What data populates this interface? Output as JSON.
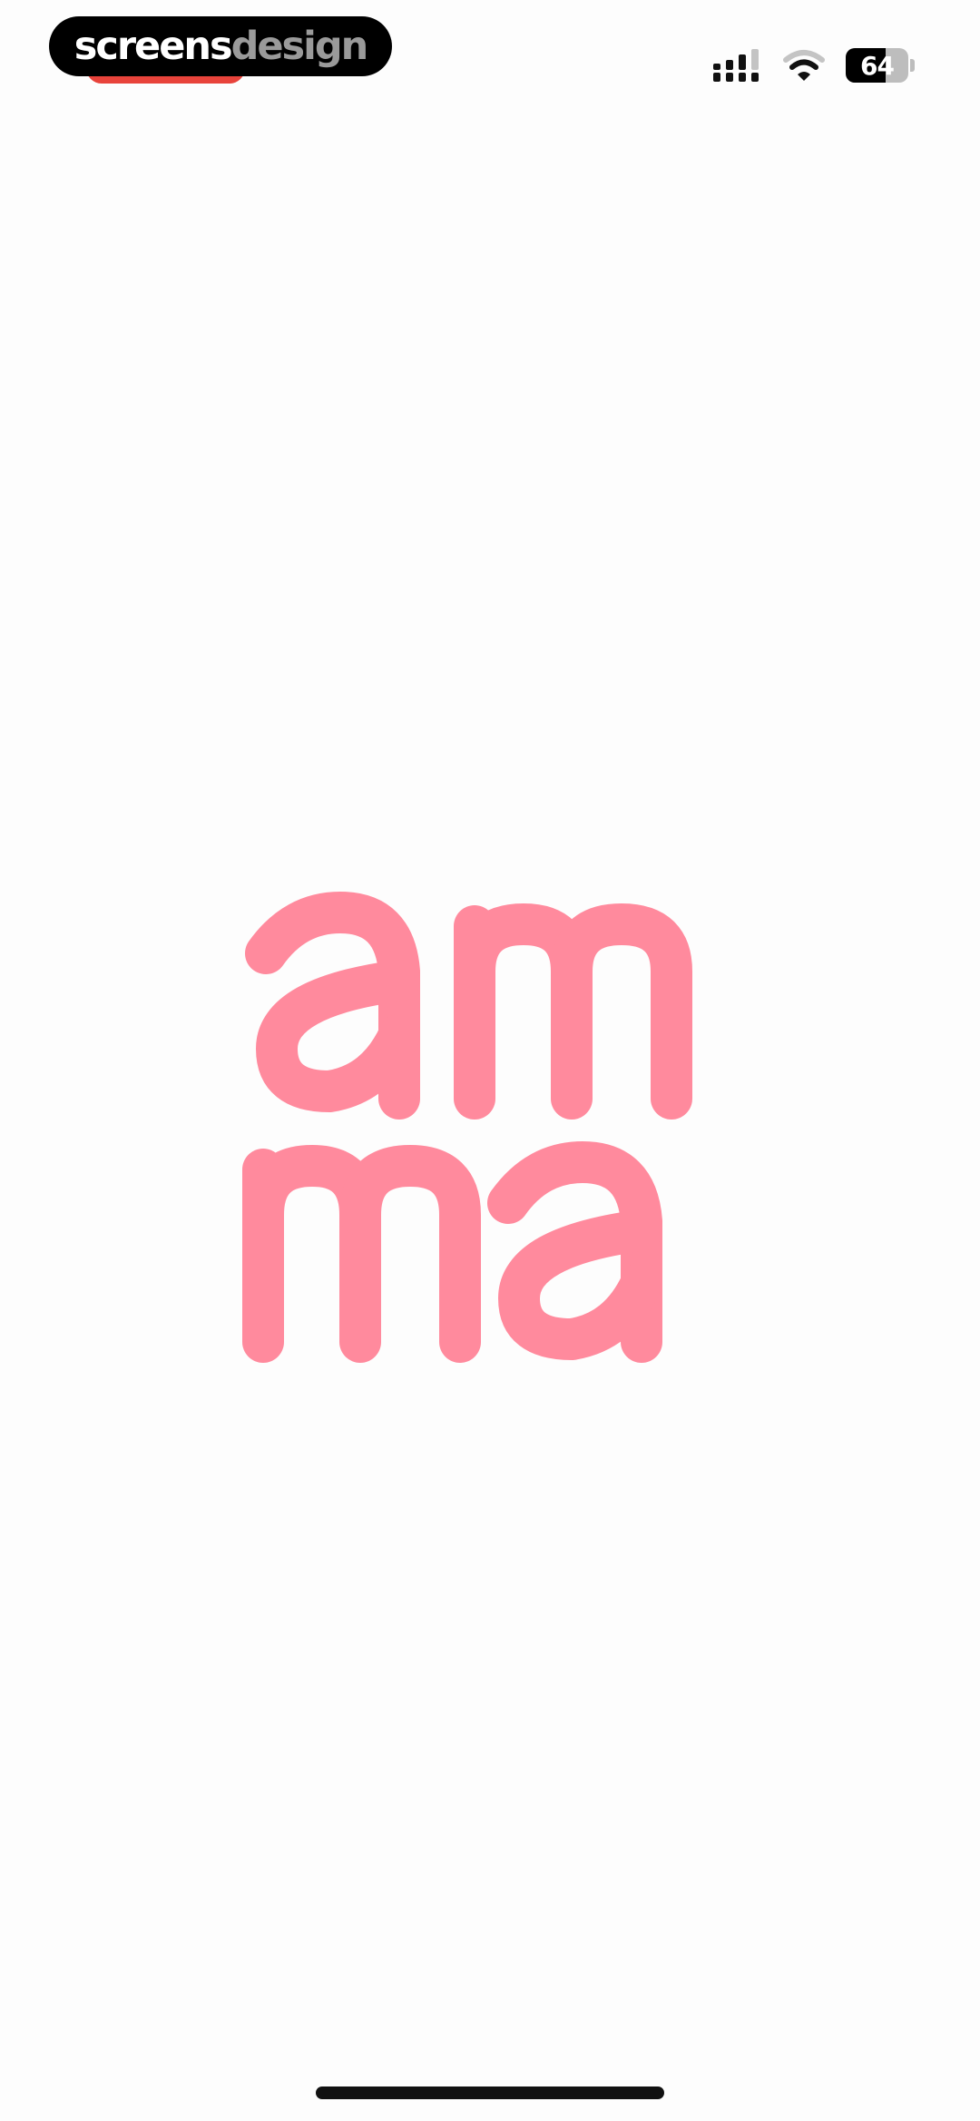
{
  "watermark": {
    "part1": "screens",
    "part2": "design"
  },
  "status_bar": {
    "battery_level": "64",
    "battery_fraction": 0.64,
    "icons": [
      "signal-icon",
      "wifi-icon",
      "battery-icon"
    ]
  },
  "logo": {
    "line1": "am",
    "line2": "ma",
    "color": "#ff8a9d"
  },
  "colors": {
    "background": "#fdfdfd",
    "brand_pink": "#ff8a9d",
    "recording_red": "#e8433b"
  }
}
